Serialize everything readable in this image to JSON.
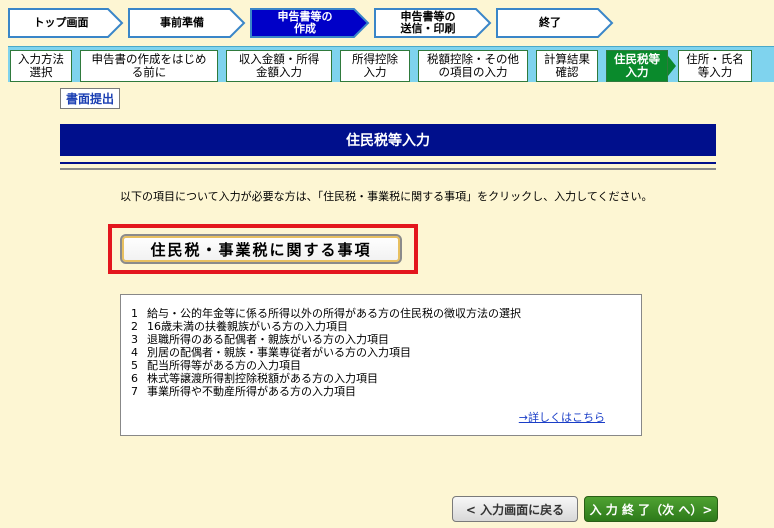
{
  "steps": [
    {
      "label": "トップ画面",
      "active": false
    },
    {
      "label": "事前準備",
      "active": false
    },
    {
      "label": "申告書等の\n作成",
      "active": true
    },
    {
      "label": "申告書等の\n送信・印刷",
      "active": false
    },
    {
      "label": "終了",
      "active": false
    }
  ],
  "subtabs": [
    {
      "label": "入力方法\n選択",
      "active": false
    },
    {
      "label": "申告書の作成をはじめ\nる前に",
      "active": false
    },
    {
      "label": "収入金額・所得\n金額入力",
      "active": false
    },
    {
      "label": "所得控除\n入力",
      "active": false
    },
    {
      "label": "税額控除・その他\nの項目の入力",
      "active": false
    },
    {
      "label": "計算結果\n確認",
      "active": false
    },
    {
      "label": "住民税等\n入力",
      "active": true
    },
    {
      "label": "住所・氏名\n等入力",
      "active": false
    }
  ],
  "submit_button": "書面提出",
  "page_title": "住民税等入力",
  "intro_text": "以下の項目について入力が必要な方は、「住民税・事業税に関する事項」をクリックし、入力してください。",
  "main_button": "住民税・事業税に関する事項",
  "items": [
    {
      "num": "1",
      "text": "給与・公的年金等に係る所得以外の所得がある方の住民税の徴収方法の選択"
    },
    {
      "num": "2",
      "text": "16歳未満の扶養親族がいる方の入力項目"
    },
    {
      "num": "3",
      "text": "退職所得のある配偶者・親族がいる方の入力項目"
    },
    {
      "num": "4",
      "text": "別居の配偶者・親族・事業専従者がいる方の入力項目"
    },
    {
      "num": "5",
      "text": "配当所得等がある方の入力項目"
    },
    {
      "num": "6",
      "text": "株式等譲渡所得割控除税額がある方の入力項目"
    },
    {
      "num": "7",
      "text": "事業所得や不動産所得がある方の入力項目"
    }
  ],
  "detail_link": "→詳しくはこちら",
  "back_button": "< 入力画面に戻る",
  "next_button": "入 力 終 了（次 へ）>",
  "colors": {
    "active_step": "#0000c8",
    "title_bar": "#000f8c",
    "active_tab": "#0a8a2c",
    "highlight_border": "#e3161d"
  }
}
